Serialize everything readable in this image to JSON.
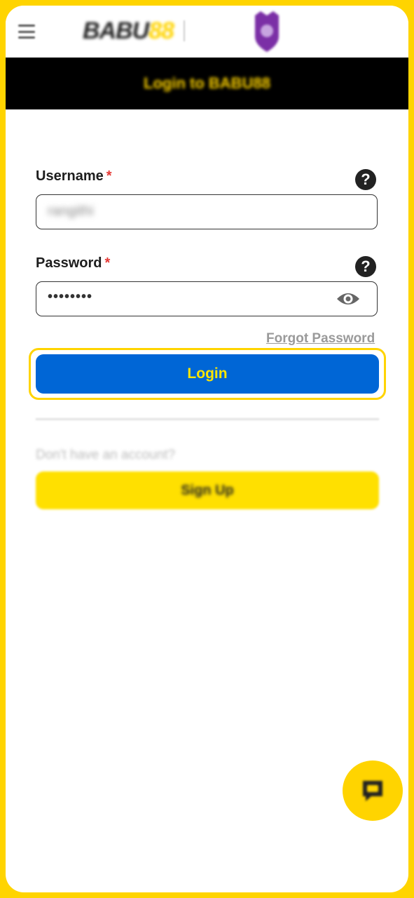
{
  "header": {
    "logo_text_dark": "BABU",
    "logo_text_accent": "88",
    "menu_icon": "hamburger-menu-icon",
    "partner_icon": "shield-badge-icon"
  },
  "banner": {
    "title": "Login to BABU88"
  },
  "form": {
    "username": {
      "label": "Username",
      "required_mark": "*",
      "value": "rangithi"
    },
    "password": {
      "label": "Password",
      "required_mark": "*",
      "value": "••••••••",
      "toggle_icon": "eye-icon"
    },
    "help_glyph": "?",
    "forgot_link": "Forgot Password",
    "login_button": "Login",
    "no_account_text": "Don't have an account?",
    "signup_button": "Sign Up"
  },
  "chat": {
    "icon": "chat-support-icon"
  },
  "colors": {
    "accent_yellow": "#ffd400",
    "primary_blue": "#0066d6",
    "banner_black": "#000000",
    "required_red": "#e53935"
  }
}
